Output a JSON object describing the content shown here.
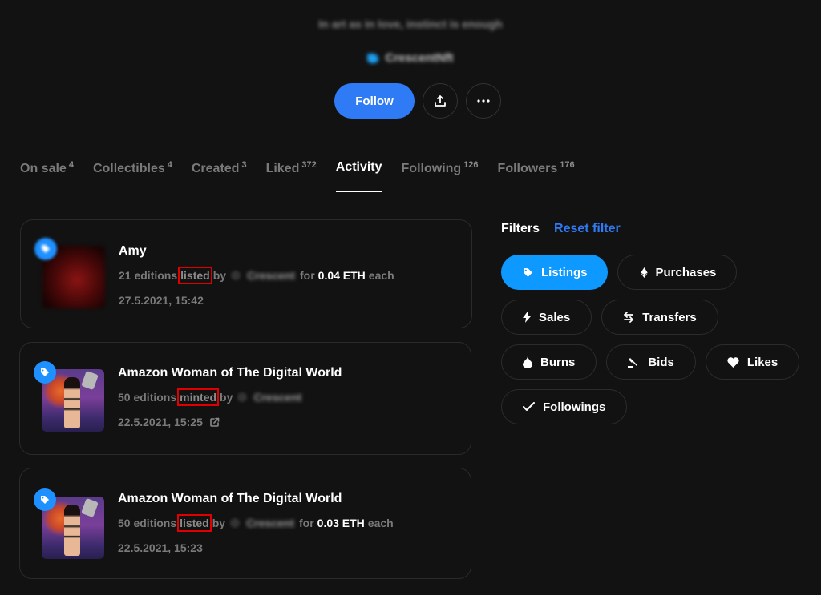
{
  "profile": {
    "bio": "In art as in love, instinct is enough",
    "twitter_handle": "CrescentNft",
    "follow_label": "Follow"
  },
  "tabs": [
    {
      "label": "On sale",
      "count": "4",
      "active": false
    },
    {
      "label": "Collectibles",
      "count": "4",
      "active": false
    },
    {
      "label": "Created",
      "count": "3",
      "active": false
    },
    {
      "label": "Liked",
      "count": "372",
      "active": false
    },
    {
      "label": "Activity",
      "count": "",
      "active": true
    },
    {
      "label": "Following",
      "count": "126",
      "active": false
    },
    {
      "label": "Followers",
      "count": "176",
      "active": false
    }
  ],
  "activity": [
    {
      "title": "Amy",
      "editions": "21 editions",
      "action": "listed",
      "by": "by",
      "user": "Crescent",
      "for": "for",
      "price": "0.04 ETH",
      "each": "each",
      "date": "27.5.2021, 15:42",
      "badge_icon": "tag-icon",
      "external_link": false
    },
    {
      "title": "Amazon Woman of The Digital World",
      "editions": "50 editions",
      "action": "minted",
      "by": "by",
      "user": "Crescent",
      "for": "",
      "price": "",
      "each": "",
      "date": "22.5.2021, 15:25",
      "badge_icon": "tag-icon",
      "external_link": true
    },
    {
      "title": "Amazon Woman of The Digital World",
      "editions": "50 editions",
      "action": "listed",
      "by": "by",
      "user": "Crescent",
      "for": "for",
      "price": "0.03 ETH",
      "each": "each",
      "date": "22.5.2021, 15:23",
      "badge_icon": "tag-icon",
      "external_link": false
    }
  ],
  "filters": {
    "title": "Filters",
    "reset_label": "Reset filter",
    "items": [
      {
        "label": "Listings",
        "icon": "tag-icon",
        "active": true
      },
      {
        "label": "Purchases",
        "icon": "ethereum-icon",
        "active": false
      },
      {
        "label": "Sales",
        "icon": "lightning-icon",
        "active": false
      },
      {
        "label": "Transfers",
        "icon": "transfer-arrows-icon",
        "active": false
      },
      {
        "label": "Burns",
        "icon": "flame-icon",
        "active": false
      },
      {
        "label": "Bids",
        "icon": "gavel-icon",
        "active": false
      },
      {
        "label": "Likes",
        "icon": "heart-icon",
        "active": false
      },
      {
        "label": "Followings",
        "icon": "check-icon",
        "active": false
      }
    ]
  },
  "colors": {
    "background": "#121212",
    "accent_blue": "#2f7bf5",
    "active_chip": "#0d99ff",
    "highlight_red": "#e00000"
  }
}
